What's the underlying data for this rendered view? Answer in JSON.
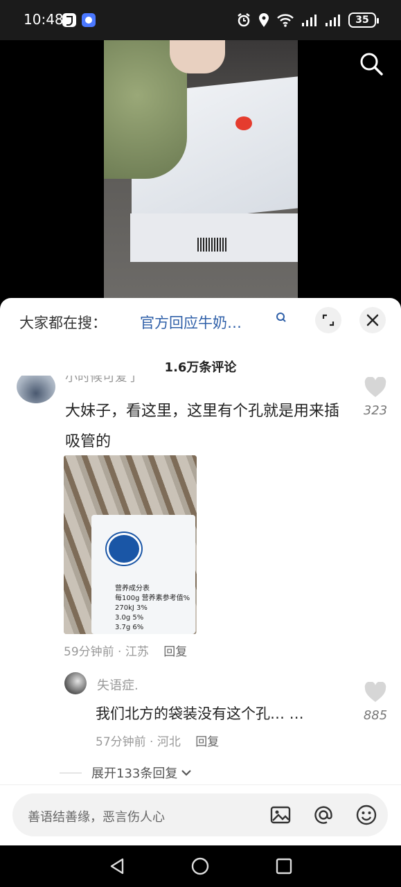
{
  "status_bar": {
    "time": "10:48",
    "battery": "35"
  },
  "hot_search": {
    "label": "大家都在搜：",
    "term": "官方回应牛奶…"
  },
  "comments_panel": {
    "count_title": "1.6万条评论",
    "main_comment": {
      "username": "小时候可爱了",
      "text": "大妹子，看这里，这里有个孔就是用来插吸管的",
      "likes": "323",
      "time_location": "59分钟前 · 江苏",
      "reply_label": "回复",
      "photo_text": {
        "label1": "营养成分表",
        "row1": "每100g 营养素参考值%",
        "row2": "270kJ  3%",
        "row3": "3.0g  5%",
        "row4": "3.7g  6%"
      }
    },
    "sub_reply": {
      "username": "失语症.",
      "text": "我们北方的袋装没有这个孔… …",
      "likes": "885",
      "time_location": "57分钟前 · 河北",
      "reply_label": "回复"
    },
    "expand_replies_label": "展开133条回复"
  },
  "input_bar": {
    "placeholder": "善语结善缘，恶言伤人心"
  },
  "colors": {
    "hot_term": "#2e5fa8",
    "tetra_blue": "#1a56a6"
  }
}
